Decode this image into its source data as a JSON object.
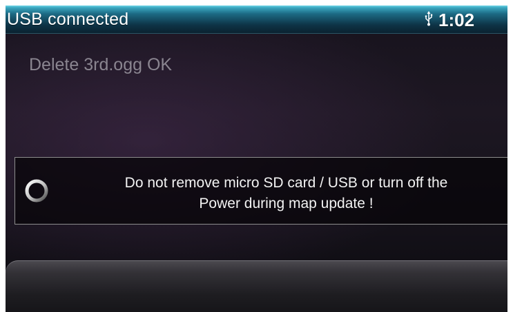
{
  "status_bar": {
    "title": "USB connected",
    "time": "1:02",
    "icons": [
      "usb-icon"
    ]
  },
  "main": {
    "message": "Delete 3rd.ogg OK"
  },
  "warning": {
    "line1": "Do not remove micro SD card / USB or turn off  the",
    "line2": "Power during map update !",
    "icon": "loading-spinner-icon"
  },
  "colors": {
    "status_bar_accent": "#1c6a84",
    "message_text": "#8a8590",
    "warning_border": "#8e8e8e"
  }
}
